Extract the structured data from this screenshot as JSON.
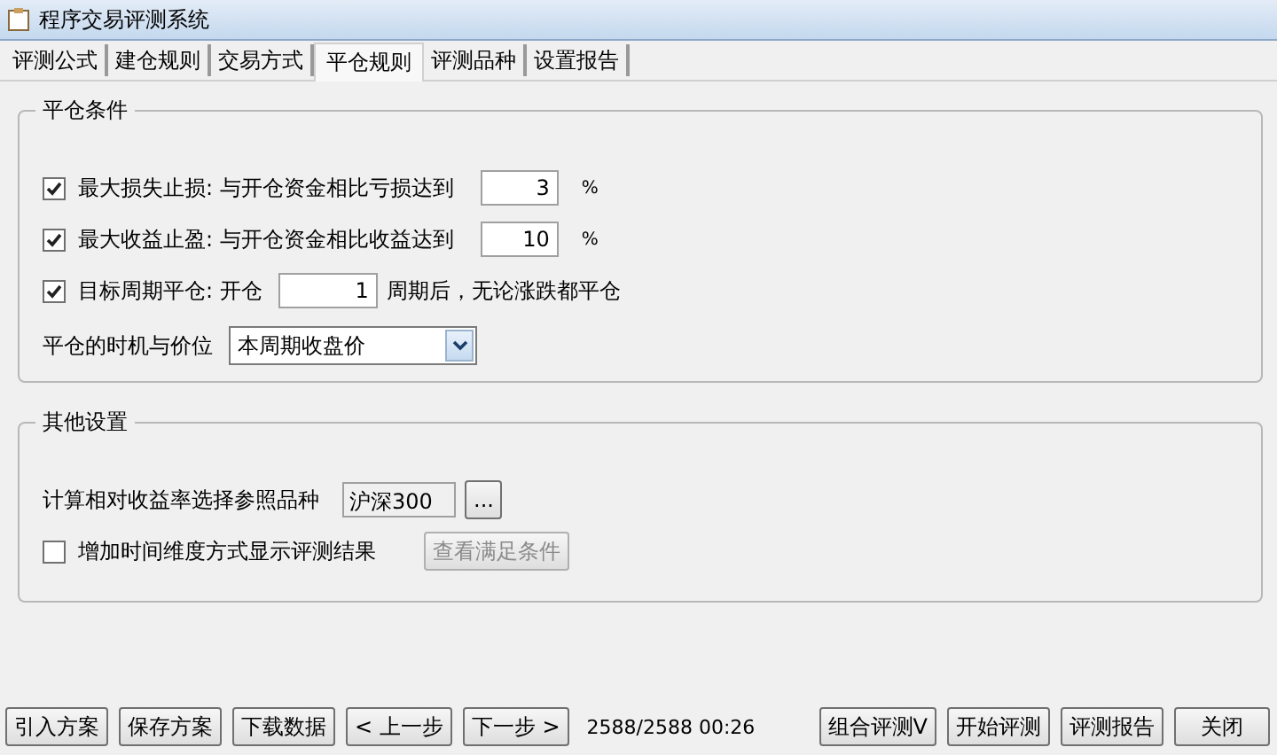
{
  "window": {
    "title": "程序交易评测系统"
  },
  "tabs": [
    {
      "label": "评测公式",
      "selected": false
    },
    {
      "label": "建仓规则",
      "selected": false
    },
    {
      "label": "交易方式",
      "selected": false
    },
    {
      "label": "平仓规则",
      "selected": true
    },
    {
      "label": "评测品种",
      "selected": false
    },
    {
      "label": "设置报告",
      "selected": false
    }
  ],
  "close_conditions": {
    "title": "平仓条件",
    "rules": [
      {
        "kind": "percent",
        "checked": true,
        "label": "最大损失止损: 与开仓资金相比亏损达到",
        "value": "3",
        "unit": "%"
      },
      {
        "kind": "percent",
        "checked": true,
        "label": "最大收益止盈: 与开仓资金相比收益达到",
        "value": "10",
        "unit": "%"
      },
      {
        "kind": "period",
        "checked": true,
        "label": "目标周期平仓: 开仓",
        "value": "1",
        "suffix": "周期后，无论涨跌都平仓"
      }
    ],
    "timing": {
      "label": "平仓的时机与价位",
      "value": "本周期收盘价"
    }
  },
  "other_settings": {
    "title": "其他设置",
    "reference": {
      "label": "计算相对收益率选择参照品种",
      "value": "沪深300",
      "browse": "..."
    },
    "time_dimension": {
      "checked": false,
      "label": "增加时间维度方式显示评测结果",
      "button": {
        "label": "查看满足条件",
        "disabled": true
      }
    }
  },
  "bottom_bar": {
    "buttons_left": [
      "引入方案",
      "保存方案",
      "下载数据",
      "< 上一步",
      "下一步 >"
    ],
    "status": "2588/2588 00:26",
    "buttons_right": [
      "组合评测V",
      "开始评测",
      "评测报告",
      "关闭"
    ]
  }
}
